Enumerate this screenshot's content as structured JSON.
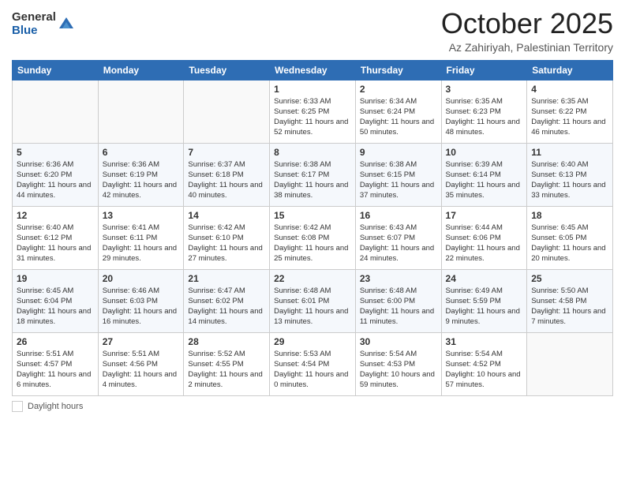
{
  "header": {
    "logo_general": "General",
    "logo_blue": "Blue",
    "month_title": "October 2025",
    "location": "Az Zahiriyah, Palestinian Territory"
  },
  "days_of_week": [
    "Sunday",
    "Monday",
    "Tuesday",
    "Wednesday",
    "Thursday",
    "Friday",
    "Saturday"
  ],
  "weeks": [
    [
      {
        "day": "",
        "content": ""
      },
      {
        "day": "",
        "content": ""
      },
      {
        "day": "",
        "content": ""
      },
      {
        "day": "1",
        "content": "Sunrise: 6:33 AM\nSunset: 6:25 PM\nDaylight: 11 hours and 52 minutes."
      },
      {
        "day": "2",
        "content": "Sunrise: 6:34 AM\nSunset: 6:24 PM\nDaylight: 11 hours and 50 minutes."
      },
      {
        "day": "3",
        "content": "Sunrise: 6:35 AM\nSunset: 6:23 PM\nDaylight: 11 hours and 48 minutes."
      },
      {
        "day": "4",
        "content": "Sunrise: 6:35 AM\nSunset: 6:22 PM\nDaylight: 11 hours and 46 minutes."
      }
    ],
    [
      {
        "day": "5",
        "content": "Sunrise: 6:36 AM\nSunset: 6:20 PM\nDaylight: 11 hours and 44 minutes."
      },
      {
        "day": "6",
        "content": "Sunrise: 6:36 AM\nSunset: 6:19 PM\nDaylight: 11 hours and 42 minutes."
      },
      {
        "day": "7",
        "content": "Sunrise: 6:37 AM\nSunset: 6:18 PM\nDaylight: 11 hours and 40 minutes."
      },
      {
        "day": "8",
        "content": "Sunrise: 6:38 AM\nSunset: 6:17 PM\nDaylight: 11 hours and 38 minutes."
      },
      {
        "day": "9",
        "content": "Sunrise: 6:38 AM\nSunset: 6:15 PM\nDaylight: 11 hours and 37 minutes."
      },
      {
        "day": "10",
        "content": "Sunrise: 6:39 AM\nSunset: 6:14 PM\nDaylight: 11 hours and 35 minutes."
      },
      {
        "day": "11",
        "content": "Sunrise: 6:40 AM\nSunset: 6:13 PM\nDaylight: 11 hours and 33 minutes."
      }
    ],
    [
      {
        "day": "12",
        "content": "Sunrise: 6:40 AM\nSunset: 6:12 PM\nDaylight: 11 hours and 31 minutes."
      },
      {
        "day": "13",
        "content": "Sunrise: 6:41 AM\nSunset: 6:11 PM\nDaylight: 11 hours and 29 minutes."
      },
      {
        "day": "14",
        "content": "Sunrise: 6:42 AM\nSunset: 6:10 PM\nDaylight: 11 hours and 27 minutes."
      },
      {
        "day": "15",
        "content": "Sunrise: 6:42 AM\nSunset: 6:08 PM\nDaylight: 11 hours and 25 minutes."
      },
      {
        "day": "16",
        "content": "Sunrise: 6:43 AM\nSunset: 6:07 PM\nDaylight: 11 hours and 24 minutes."
      },
      {
        "day": "17",
        "content": "Sunrise: 6:44 AM\nSunset: 6:06 PM\nDaylight: 11 hours and 22 minutes."
      },
      {
        "day": "18",
        "content": "Sunrise: 6:45 AM\nSunset: 6:05 PM\nDaylight: 11 hours and 20 minutes."
      }
    ],
    [
      {
        "day": "19",
        "content": "Sunrise: 6:45 AM\nSunset: 6:04 PM\nDaylight: 11 hours and 18 minutes."
      },
      {
        "day": "20",
        "content": "Sunrise: 6:46 AM\nSunset: 6:03 PM\nDaylight: 11 hours and 16 minutes."
      },
      {
        "day": "21",
        "content": "Sunrise: 6:47 AM\nSunset: 6:02 PM\nDaylight: 11 hours and 14 minutes."
      },
      {
        "day": "22",
        "content": "Sunrise: 6:48 AM\nSunset: 6:01 PM\nDaylight: 11 hours and 13 minutes."
      },
      {
        "day": "23",
        "content": "Sunrise: 6:48 AM\nSunset: 6:00 PM\nDaylight: 11 hours and 11 minutes."
      },
      {
        "day": "24",
        "content": "Sunrise: 6:49 AM\nSunset: 5:59 PM\nDaylight: 11 hours and 9 minutes."
      },
      {
        "day": "25",
        "content": "Sunrise: 5:50 AM\nSunset: 4:58 PM\nDaylight: 11 hours and 7 minutes."
      }
    ],
    [
      {
        "day": "26",
        "content": "Sunrise: 5:51 AM\nSunset: 4:57 PM\nDaylight: 11 hours and 6 minutes."
      },
      {
        "day": "27",
        "content": "Sunrise: 5:51 AM\nSunset: 4:56 PM\nDaylight: 11 hours and 4 minutes."
      },
      {
        "day": "28",
        "content": "Sunrise: 5:52 AM\nSunset: 4:55 PM\nDaylight: 11 hours and 2 minutes."
      },
      {
        "day": "29",
        "content": "Sunrise: 5:53 AM\nSunset: 4:54 PM\nDaylight: 11 hours and 0 minutes."
      },
      {
        "day": "30",
        "content": "Sunrise: 5:54 AM\nSunset: 4:53 PM\nDaylight: 10 hours and 59 minutes."
      },
      {
        "day": "31",
        "content": "Sunrise: 5:54 AM\nSunset: 4:52 PM\nDaylight: 10 hours and 57 minutes."
      },
      {
        "day": "",
        "content": ""
      }
    ]
  ],
  "footer": {
    "legend_label": "Daylight hours"
  }
}
